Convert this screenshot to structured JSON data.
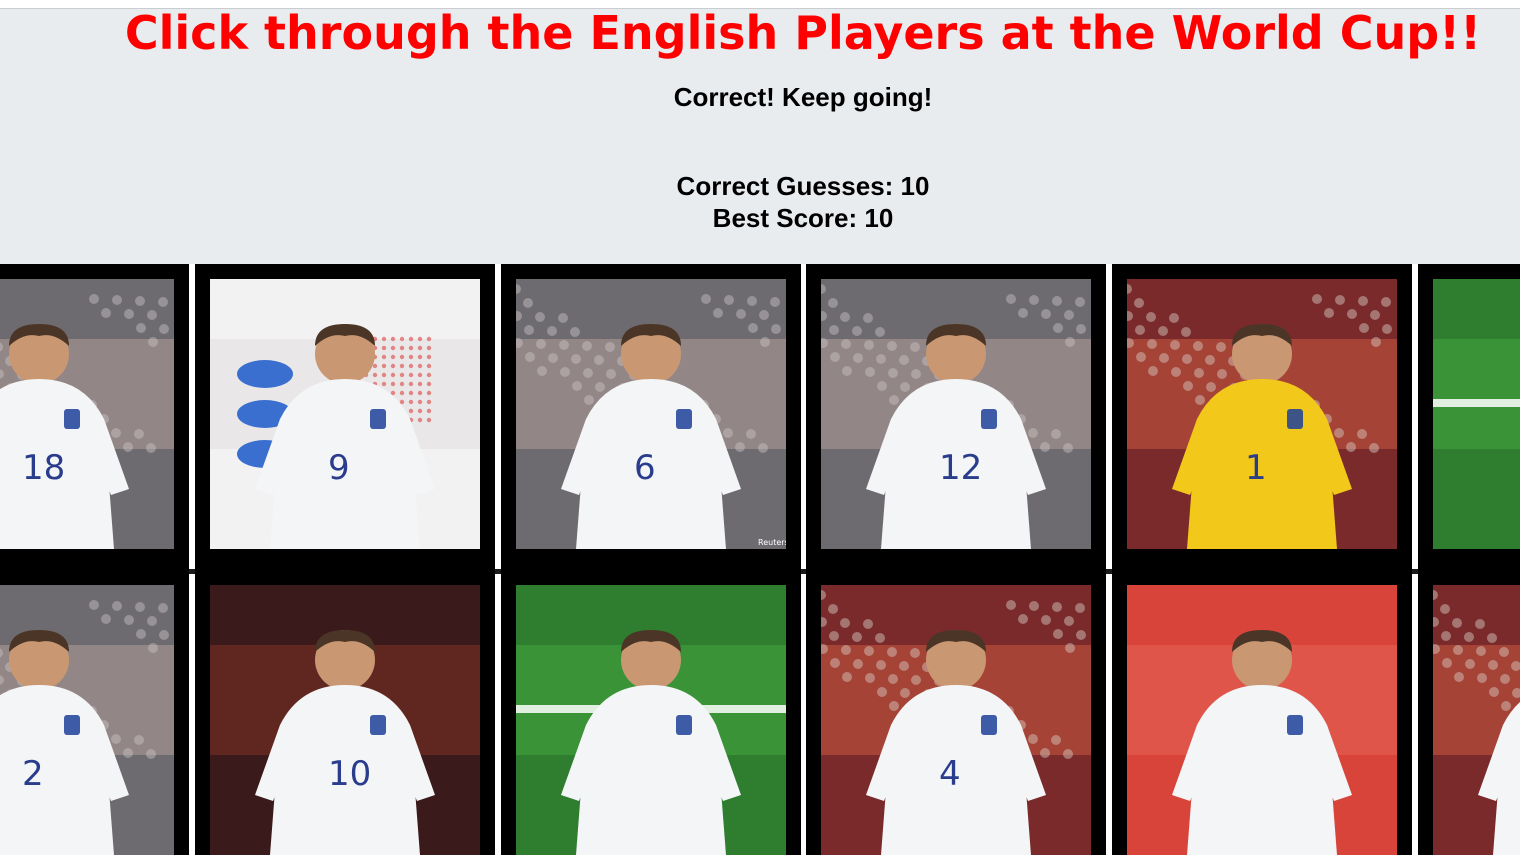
{
  "header": {
    "title": "Click through the English Players at the World Cup!!",
    "status_message": "Correct! Keep going!",
    "correct_guesses": "Correct Guesses: 10",
    "best_score": "Best Score: 10"
  },
  "colors": {
    "title": "#ff0000",
    "header_bg": "#e9ecef",
    "card_bg": "#000000",
    "shirt": "#f4f5f7",
    "keeper_shirt": "#f2c81a"
  },
  "cards": [
    {
      "name": "player-card-18",
      "shirt_number": "18",
      "bg": "crowd",
      "shirt": "white"
    },
    {
      "name": "player-card-9",
      "shirt_number": "9",
      "bg": "poster",
      "shirt": "white"
    },
    {
      "name": "player-card-6",
      "shirt_number": "6",
      "bg": "crowd",
      "shirt": "white"
    },
    {
      "name": "player-card-12",
      "shirt_number": "12",
      "bg": "crowd",
      "shirt": "white"
    },
    {
      "name": "player-card-1",
      "shirt_number": "1",
      "bg": "stadium",
      "shirt": "yellow"
    },
    {
      "name": "player-card-pitch",
      "shirt_number": "",
      "bg": "pitch",
      "shirt": "none"
    },
    {
      "name": "player-card-2",
      "shirt_number": "2",
      "bg": "crowd",
      "shirt": "white"
    },
    {
      "name": "player-card-10",
      "shirt_number": "10",
      "bg": "dark",
      "shirt": "white"
    },
    {
      "name": "player-card-grass",
      "shirt_number": "",
      "bg": "pitch",
      "shirt": "white"
    },
    {
      "name": "player-card-4",
      "shirt_number": "4",
      "bg": "stadium",
      "shirt": "white"
    },
    {
      "name": "player-card-red",
      "shirt_number": "",
      "bg": "red",
      "shirt": "white"
    },
    {
      "name": "player-card-partial",
      "shirt_number": "",
      "bg": "stadium",
      "shirt": "white"
    }
  ],
  "photo_credit": "Reuters"
}
